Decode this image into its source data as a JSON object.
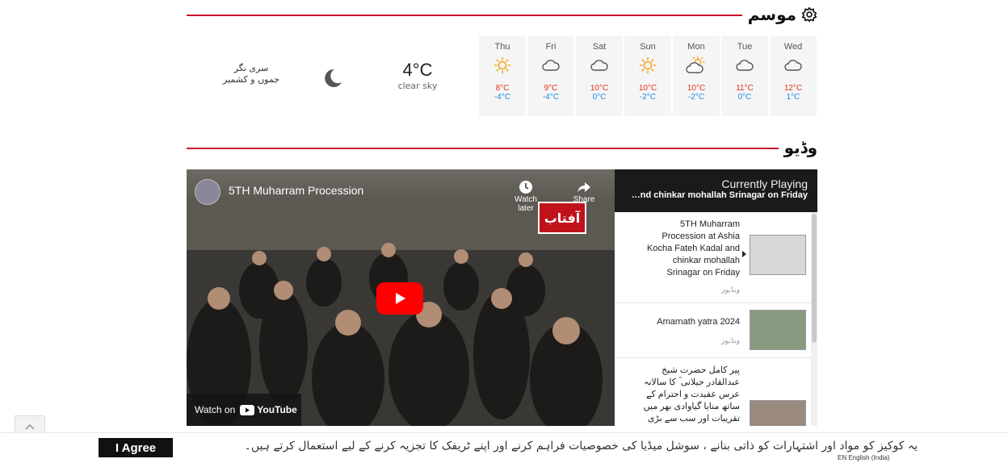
{
  "weather": {
    "title": "موسم",
    "city_line1": "سری نگر",
    "city_line2": "جموں و کشمیر",
    "current_temp": "4°C",
    "current_desc": "clear sky",
    "forecast": [
      {
        "day": "Thu",
        "icon": "sun-icon",
        "hi": "8°C",
        "lo": "-4°C"
      },
      {
        "day": "Fri",
        "icon": "cloud-icon",
        "hi": "9°C",
        "lo": "-4°C"
      },
      {
        "day": "Sat",
        "icon": "cloud-icon",
        "hi": "10°C",
        "lo": "0°C"
      },
      {
        "day": "Sun",
        "icon": "sun-icon",
        "hi": "10°C",
        "lo": "-2°C"
      },
      {
        "day": "Mon",
        "icon": "partly-cloudy-icon",
        "hi": "10°C",
        "lo": "-2°C"
      },
      {
        "day": "Tue",
        "icon": "cloud-icon",
        "hi": "11°C",
        "lo": "0°C"
      },
      {
        "day": "Wed",
        "icon": "cloud-icon",
        "hi": "12°C",
        "lo": "1°C"
      }
    ]
  },
  "video": {
    "title": "وڈیو",
    "player_title": "5TH Muharram Procession",
    "watch_later": "Watch later",
    "share": "Share",
    "watch_on": "Watch on",
    "youtube": "YouTube",
    "currently_playing": "Currently Playing",
    "current_title": "…nd chinkar mohallah Srinagar on Friday",
    "playlist": [
      {
        "text": "5TH Muharram Procession at Ashia Kocha Fateh Kadal and chinkar mohallah Srinagar on Friday",
        "source": "ویڈیوز"
      },
      {
        "text": "Amarnath yatra 2024",
        "source": "ویڈیوز"
      },
      {
        "text": "پیر کامل حضرت شیخ عبدالقادر جیلانی ؒ کا سالانہ عرس عقیدت و احترام کے ساتھ منایا گیاوادی بھر میں تقریبات اور سب سے بڑی",
        "source": ""
      }
    ]
  },
  "cookie": {
    "message": "یہ کوکیز کو مواد اور اشتہارات کو ذاتی بنانے ، سوشل میڈیا کی خصوصیات فراہم کرنے اور اپنے ٹریفک کا تجزیہ کرنے کے لیے استعمال کرتے ہیں۔",
    "agree": "I Agree",
    "language": "EN English (India)"
  },
  "colors": {
    "accent": "#c8102e",
    "hi_temp": "#e0301e",
    "lo_temp": "#1e88e5"
  }
}
